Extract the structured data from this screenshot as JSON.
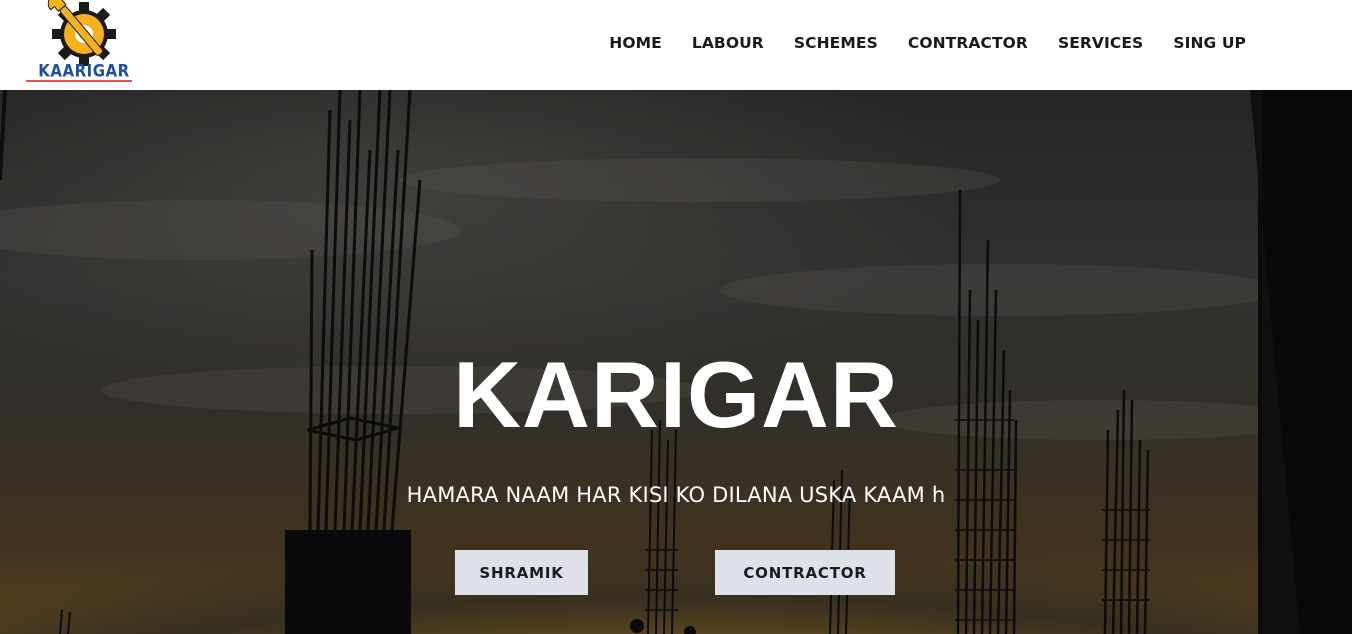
{
  "logo": {
    "text": "KAARIGAR",
    "gear_color": "#f5b21b",
    "tool_color": "#f5b21b",
    "text_color": "#1f4f9c"
  },
  "nav": {
    "items": [
      {
        "label": "HOME"
      },
      {
        "label": "LABOUR"
      },
      {
        "label": "SCHEMES"
      },
      {
        "label": "CONTRACTOR"
      },
      {
        "label": "SERVICES"
      },
      {
        "label": "SING UP"
      }
    ]
  },
  "hero": {
    "title": "KARIGAR",
    "subtitle": "HAMARA NAAM HAR KISI KO DILANA USKA KAAM h",
    "buttons": {
      "shramik": "SHRAMIK",
      "contractor": "CONTRACTOR"
    }
  },
  "colors": {
    "header_bg": "#ffffff",
    "nav_text": "#1a1a1a",
    "button_bg": "#dde1e8"
  }
}
